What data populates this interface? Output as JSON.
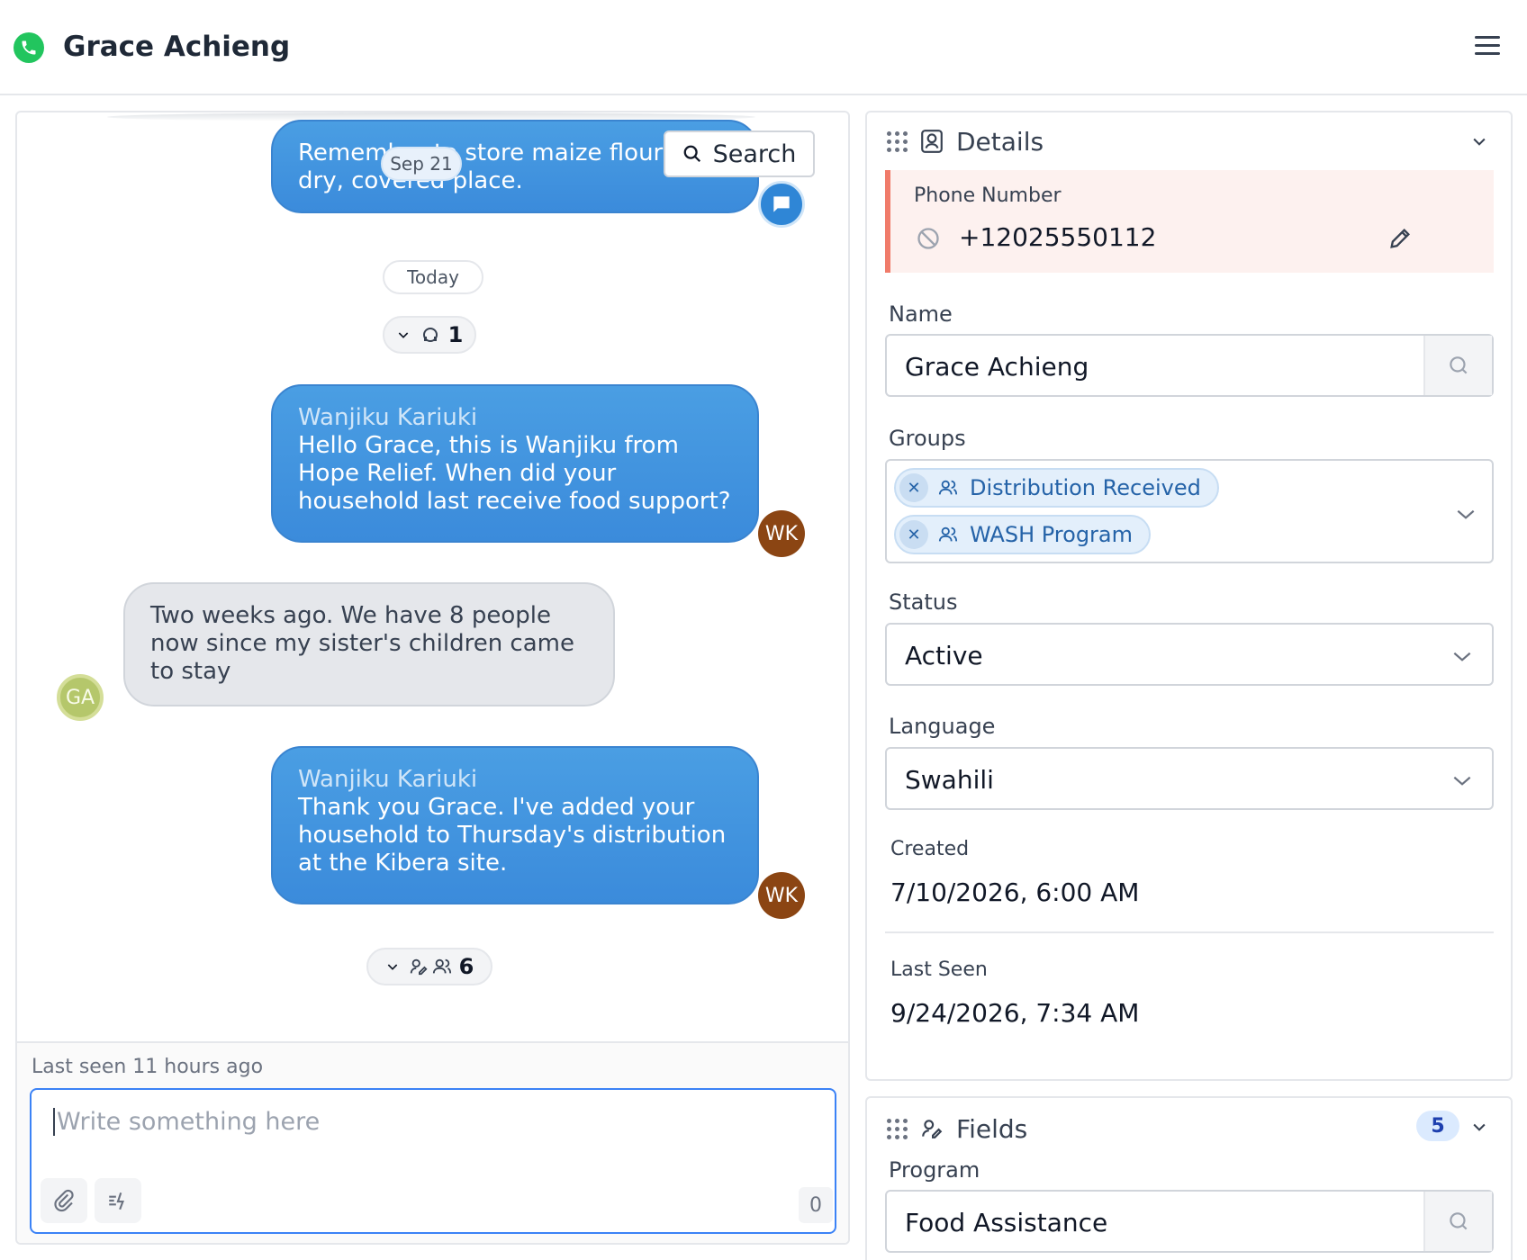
{
  "header": {
    "title": "Grace Achieng",
    "channel_icon": "phone-icon",
    "menu_icon": "hamburger-menu-icon"
  },
  "chat": {
    "search_label": "Search",
    "messages": [
      {
        "direction": "out",
        "sender": "",
        "text": "Remember to store maize flour in a dry, covered place.",
        "avatar": ""
      },
      {
        "direction": "out",
        "sender": "Wanjiku Kariuki",
        "text": "Hello Grace, this is Wanjiku from Hope Relief. When did your household last receive food support?",
        "avatar": "WK"
      },
      {
        "direction": "in",
        "sender": "",
        "text": "Two weeks ago. We have 8 people now since my sister's children came to stay",
        "avatar": "GA"
      },
      {
        "direction": "out",
        "sender": "Wanjiku Kariuki",
        "text": "Thank you Grace. I've added your household to Thursday's distribution at the Kibera site.",
        "avatar": "WK"
      }
    ],
    "date_sep_1": "Sep 21",
    "date_sep_2": "Today",
    "events_pill_1_count": "1",
    "events_pill_2_count": "6",
    "last_seen": "Last seen 11 hours ago",
    "composer_placeholder": "Write something here",
    "char_count": "0"
  },
  "details": {
    "title": "Details",
    "phone_label": "Phone Number",
    "phone_value": "+12025550112",
    "name_label": "Name",
    "name_value": "Grace Achieng",
    "groups_label": "Groups",
    "groups": [
      "Distribution Received",
      "WASH Program"
    ],
    "status_label": "Status",
    "status_value": "Active",
    "language_label": "Language",
    "language_value": "Swahili",
    "created_label": "Created",
    "created_value": "7/10/2026, 6:00 AM",
    "last_seen_label": "Last Seen",
    "last_seen_value": "9/24/2026, 7:34 AM"
  },
  "fields": {
    "title": "Fields",
    "count": "5",
    "program_label": "Program",
    "program_value": "Food Assistance"
  },
  "colors": {
    "accent": "#3b8bdb",
    "online": "#22c55e",
    "warning": "#f07b6a"
  }
}
